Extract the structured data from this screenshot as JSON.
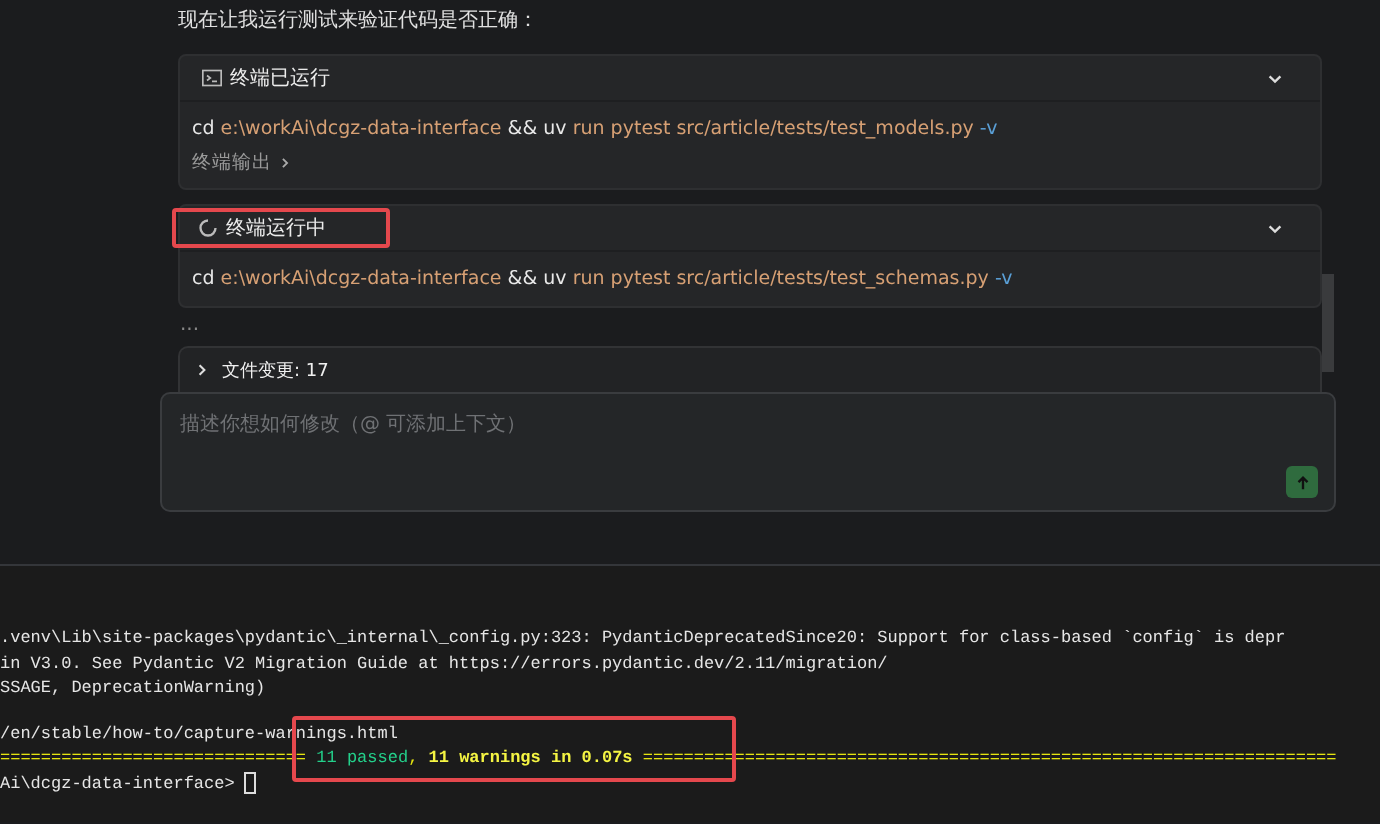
{
  "chat": {
    "intro": "现在让我运行测试来验证代码是否正确：",
    "cards": [
      {
        "kind": "done",
        "title": "终端已运行",
        "expanded": true,
        "highlighted": false,
        "command": [
          {
            "kind": "command",
            "text": "cd"
          },
          {
            "kind": "argument",
            "text": "e:\\workAi\\dcgz-data-interface"
          },
          {
            "kind": "operator",
            "text": "&&"
          },
          {
            "kind": "command",
            "text": "uv"
          },
          {
            "kind": "argument",
            "text": "run pytest src/article/tests/test_models.py"
          },
          {
            "kind": "flag",
            "text": "-v"
          }
        ],
        "output_link": "终端输出"
      },
      {
        "kind": "running",
        "title": "终端运行中",
        "expanded": true,
        "highlighted": true,
        "command": [
          {
            "kind": "command",
            "text": "cd"
          },
          {
            "kind": "argument",
            "text": "e:\\workAi\\dcgz-data-interface"
          },
          {
            "kind": "operator",
            "text": "&&"
          },
          {
            "kind": "command",
            "text": "uv"
          },
          {
            "kind": "argument",
            "text": "run pytest src/article/tests/test_schemas.py"
          },
          {
            "kind": "flag",
            "text": "-v"
          }
        ]
      }
    ],
    "more": "...",
    "file_changes": {
      "label": "文件变更: 17",
      "expanded": false
    },
    "input": {
      "placeholder": "描述你想如何修改（@ 可添加上下文）"
    }
  },
  "terminal": {
    "lines": [
      ".venv\\Lib\\site-packages\\pydantic\\_internal\\_config.py:323: PydanticDeprecatedSince20: Support for class-based `config` is depr",
      "in V3.0. See Pydantic V2 Migration Guide at https://errors.pydantic.dev/2.11/migration/",
      "SSAGE, DeprecationWarning)",
      "/en/stable/how-to/capture-warnings.html"
    ],
    "summary": {
      "left_rule": "==============================",
      "passed": "11 passed",
      "separator": ",",
      "warnings": "11 warnings in 0.07s",
      "right_rule": "====================================================================",
      "highlighted": true
    },
    "prompt": "Ai\\dcgz-data-interface>"
  }
}
